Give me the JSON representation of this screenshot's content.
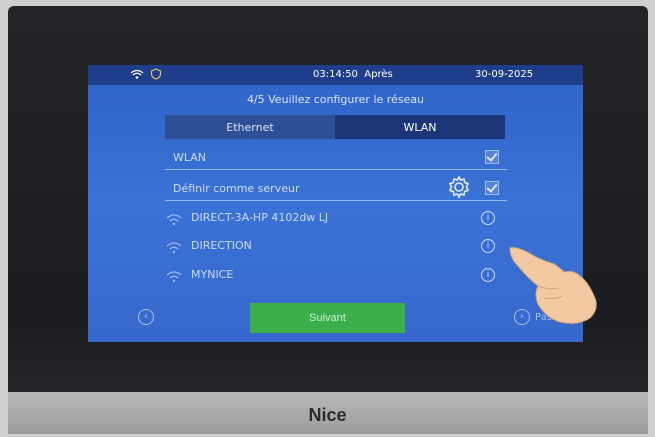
{
  "status": {
    "time": "03:14:50",
    "period": "Après",
    "date": "30-09-2025",
    "icons": [
      "wifi-icon",
      "shield-icon"
    ]
  },
  "wizard": {
    "step": "4/5 Veuillez configurer le réseau"
  },
  "tabs": [
    {
      "label": "Ethernet",
      "selected": false
    },
    {
      "label": "WLAN",
      "selected": true
    }
  ],
  "settings": {
    "wlan_label": "WLAN",
    "wlan_checked": true,
    "server_label": "Définir comme serveur",
    "server_checked": true
  },
  "networks": [
    {
      "name": "DIRECT-3A-HP 4102dw LJ"
    },
    {
      "name": "DIRECTION"
    },
    {
      "name": "MYNICE"
    }
  ],
  "buttons": {
    "next": "Suivant",
    "skip": "Passer"
  },
  "brand": "Nice",
  "colors": {
    "screen_bg": "#3a72d6",
    "status_bar": "#1e3e8c",
    "accent_green": "#3bb04a"
  }
}
